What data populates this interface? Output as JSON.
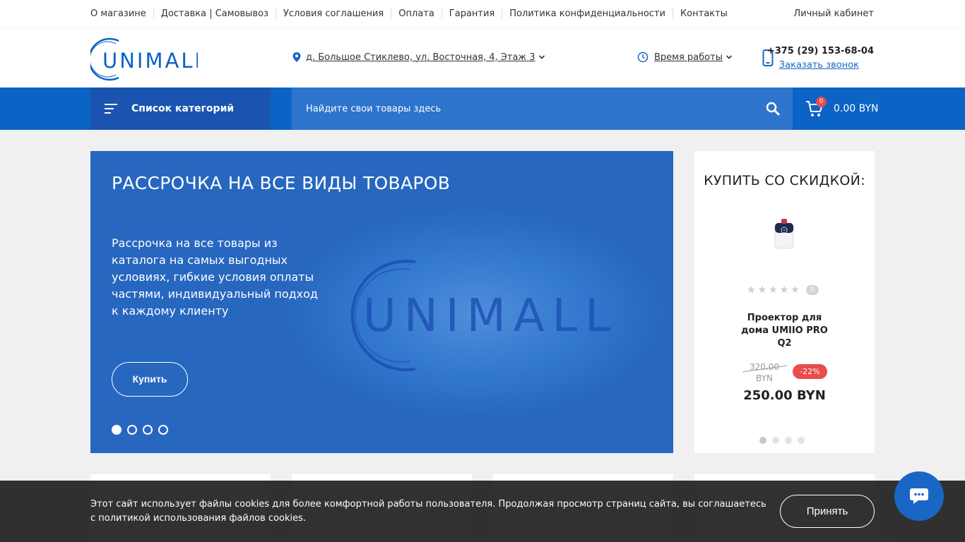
{
  "topnav": {
    "links": [
      "О магазине",
      "Доставка | Самовывоз",
      "Условия соглашения",
      "Оплата",
      "Гарантия",
      "Политика конфиденциальности",
      "Контакты"
    ],
    "cabinet": "Личный кабинет"
  },
  "header": {
    "logo_text": "UNIMALL",
    "address": "д. Большое Стиклево, ул. Восточная, 4, Этаж 3",
    "hours": "Время работы",
    "phone": "+375 (29) 153-68-04",
    "callback": "Заказать звонок"
  },
  "nav": {
    "categories": "Список категорий",
    "search_placeholder": "Найдите свои товары здесь",
    "cart_count": "0",
    "cart_total": "0.00 BYN"
  },
  "hero": {
    "title": "РАССРОЧКА НА ВСЕ ВИДЫ ТОВАРОВ",
    "text": "Рассрочка на все товары из каталога на самых выгодных условиях, гибкие условия оплаты частями, индивидуальный подход к каждому клиенту",
    "button": "Купить",
    "logo_text": "UNIMALL",
    "slides": 4,
    "active_slide": 0
  },
  "deal": {
    "title": "КУПИТЬ СО СКИДКОЙ:",
    "rating_stars": 5,
    "rating": 0,
    "rating_count": "0",
    "product": "Проектор для дома UMIIO PRO Q2",
    "old_price": "320.00 BYN",
    "discount": "-22%",
    "price": "250.00 BYN",
    "slides": 4,
    "active_slide": 0
  },
  "cookie": {
    "text": "Этот сайт использует файлы cookies для более комфортной работы пользователя. Продолжая просмотр страниц сайта, вы соглашаетесь с политикой использования файлов cookies.",
    "button": "Принять"
  },
  "colors": {
    "primary": "#0b63c5",
    "categories_bg": "#1a54b0",
    "search_bg": "#2d74cc",
    "badge": "#e84c4c"
  }
}
